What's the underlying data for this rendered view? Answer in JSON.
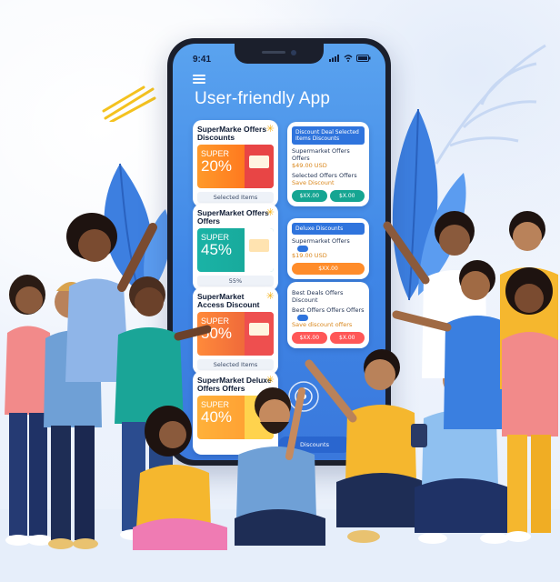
{
  "phone": {
    "status_time": "9:41",
    "app_title": "User-friendly App",
    "offer_cards": [
      {
        "head": "SuperMarke Offers Discounts",
        "super": "SUPER",
        "percent": "20%",
        "tag": "",
        "foot": "Selected Items"
      },
      {
        "head": "SuperMarket Offers Offers",
        "super": "SUPER",
        "percent": "45%",
        "tag": "",
        "foot": "55%"
      },
      {
        "head": "SuperMarket Access Discount",
        "super": "SUPER",
        "percent": "50%",
        "tag": "",
        "foot": "Selected Items"
      },
      {
        "head": "SuperMarket Deluxe Offers Offers",
        "super": "SUPER",
        "percent": "40%",
        "tag": "",
        "foot": ""
      }
    ],
    "list_cards": [
      {
        "header": "Discount Deal Selected Items Discounts",
        "lines": [
          "Supermarket Offers Offers",
          "$49.00 USD",
          "Selected Offers Offers",
          "Save Discount"
        ],
        "buttons": [
          "$XX.00",
          "$X.00"
        ]
      },
      {
        "header": "Deluxe Discounts",
        "lines": [
          "Supermarket Offers",
          "$19.00 USD"
        ],
        "buttons": [
          "$XX.00"
        ]
      },
      {
        "header": "",
        "lines": [
          "Best Deals Offers Discount",
          "Best Offers Offers Offers",
          "Save discount offers"
        ],
        "buttons": [
          "$XX.00",
          "$X.00"
        ]
      }
    ],
    "bottom_pill": "Discounts"
  },
  "colors": {
    "screen_top": "#5aa3ef",
    "screen_bottom": "#3a78dc",
    "accent_blue": "#2f74dd",
    "accent_orange": "#ff8c2a",
    "accent_teal": "#15a592",
    "accent_red": "#ff5757"
  }
}
